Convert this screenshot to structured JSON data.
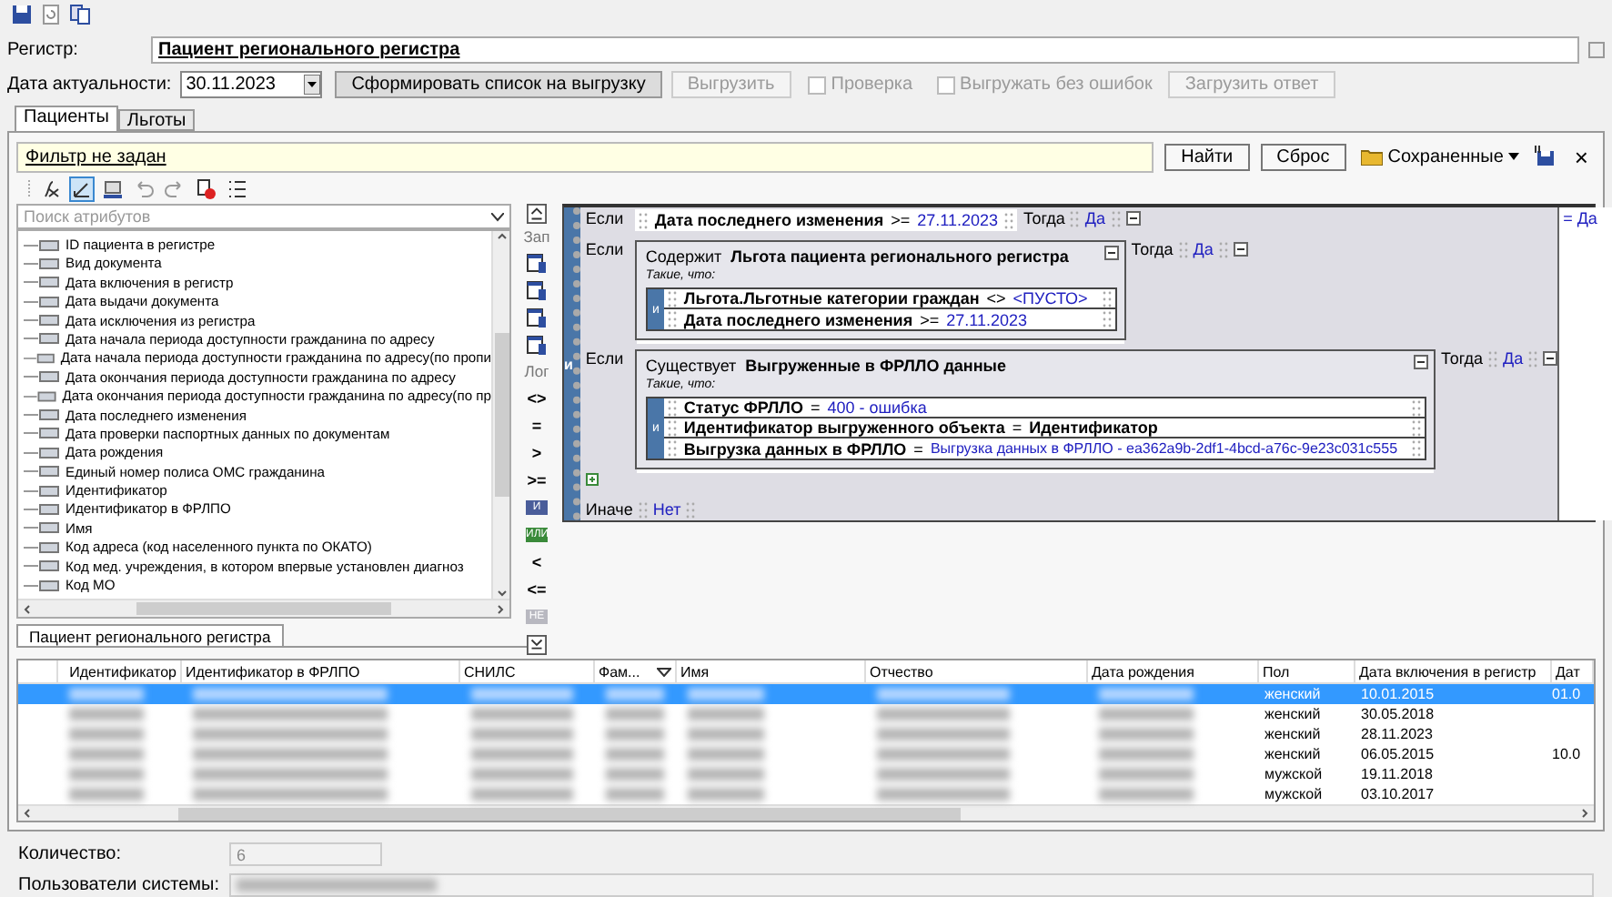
{
  "register": {
    "label": "Регистр:",
    "value": "Пациент регионального регистра"
  },
  "actuality": {
    "label": "Дата актуальности:",
    "date": "30.11.2023"
  },
  "actions": [
    {
      "kind": "button",
      "label": "Сформировать список на выгрузку",
      "disabled": false
    },
    {
      "kind": "button",
      "label": "Выгрузить",
      "disabled": true
    },
    {
      "kind": "checkbox",
      "label": "Проверка",
      "checked": false,
      "disabled": true
    },
    {
      "kind": "checkbox",
      "label": "Выгружать без ошибок",
      "checked": false,
      "disabled": true
    },
    {
      "kind": "button",
      "label": "Загрузить ответ",
      "disabled": true
    }
  ],
  "tabs": [
    {
      "label": "Пациенты",
      "selected": true
    },
    {
      "label": "Льготы",
      "selected": false
    }
  ],
  "filter": {
    "text": "Фильтр не задан",
    "buttons": [
      "Найти",
      "Сброс"
    ],
    "saved": "Сохраненные",
    "close": "×"
  },
  "attribute_search": {
    "placeholder": "Поиск атрибутов"
  },
  "attributes": [
    "ID пациента в регистре",
    "Вид документа",
    "Дата включения в регистр",
    "Дата выдачи документа",
    "Дата исключения из регистра",
    "Дата начала периода доступности гражданина по адресу",
    "Дата начала периода доступности гражданина по адресу(по пропи",
    "Дата окончания периода доступности гражданина по адресу",
    "Дата окончания периода доступности гражданина по адресу(по пр",
    "Дата последнего изменения",
    "Дата проверки паспортных данных по документам",
    "Дата рождения",
    "Единый номер полиса ОМС гражданина",
    "Идентификатор",
    "Идентификатор в ФРЛПО",
    "Имя",
    "Код адреса (код населенного пункта по ОКАТО)",
    "Код мед. учреждения, в котором впервые установлен диагноз",
    "Код МО"
  ],
  "side_toolbar": {
    "record_label": "Зап",
    "logic_label": "Лог",
    "operators": [
      {
        "kind": "compare",
        "label": "<>"
      },
      {
        "kind": "compare",
        "label": "="
      },
      {
        "kind": "compare",
        "label": ">"
      },
      {
        "kind": "compare",
        "label": ">="
      },
      {
        "kind": "and",
        "label": "И"
      },
      {
        "kind": "or",
        "label": "ИЛИ"
      },
      {
        "kind": "compare",
        "label": "<"
      },
      {
        "kind": "compare",
        "label": "<="
      },
      {
        "kind": "not",
        "label": "НЕ"
      }
    ]
  },
  "rule": {
    "operator": "и",
    "result": "= Да",
    "conditions": [
      {
        "kind": "simple",
        "if": "Если",
        "field": "Дата последнего изменения",
        "op": ">=",
        "value": "27.11.2023",
        "then": "Тогда",
        "result": "Да"
      },
      {
        "kind": "nested",
        "if": "Если",
        "quantifier": "Содержит",
        "entity": "Льгота пациента регионального регистра",
        "such_that": "Такие, что:",
        "operator": "и",
        "rows": [
          {
            "kind": "value",
            "field": "Льгота.Льготные категории граждан",
            "op": "<>",
            "value": "<ПУСТО>"
          },
          {
            "kind": "value",
            "field": "Дата последнего изменения",
            "op": ">=",
            "value": "27.11.2023"
          }
        ],
        "then": "Тогда",
        "result": "Да"
      },
      {
        "kind": "nested",
        "if": "Если",
        "quantifier": "Существует",
        "entity": "Выгруженные в ФРЛЛО данные",
        "such_that": "Такие, что:",
        "operator": "и",
        "rows": [
          {
            "kind": "value",
            "field": "Статус ФРЛЛО",
            "op": "=",
            "value": "400 - ошибка"
          },
          {
            "kind": "field",
            "field": "Идентификатор выгруженного объекта",
            "op": "=",
            "value": "Идентификатор"
          },
          {
            "kind": "reference",
            "field": "Выгрузка данных в ФРЛЛО",
            "op": "=",
            "value": "Выгрузка данных в ФРЛЛО - ea362a9b-2df1-4bcd-a76c-9e23c031c555"
          }
        ],
        "then": "Тогда",
        "result": "Да"
      }
    ],
    "else": {
      "label": "Иначе",
      "result": "Нет"
    }
  },
  "bottom_tabs": [
    {
      "label": "Пациент регионального регистра",
      "selected": true
    }
  ],
  "table": {
    "columns": [
      "Идентификатор",
      "Идентификатор в ФРЛПО",
      "СНИЛС",
      "Фам...",
      "Имя",
      "Отчество",
      "Дата рождения",
      "Пол",
      "Дата включения в регистр",
      "Дат"
    ],
    "rows": [
      {
        "selected": true,
        "gender": "женский",
        "included": "10.01.2015",
        "column_10": "01.0"
      },
      {
        "selected": false,
        "gender": "женский",
        "included": "30.05.2018"
      },
      {
        "selected": false,
        "gender": "женский",
        "included": "28.11.2023"
      },
      {
        "selected": false,
        "gender": "женский",
        "included": "06.05.2015",
        "column_10": "10.0"
      },
      {
        "selected": false,
        "gender": "мужской",
        "included": "19.11.2018"
      },
      {
        "selected": false,
        "gender": "мужской",
        "included": "03.10.2017"
      }
    ]
  },
  "count": {
    "label": "Количество:",
    "value": "6"
  },
  "users": {
    "label": "Пользователи системы:"
  }
}
